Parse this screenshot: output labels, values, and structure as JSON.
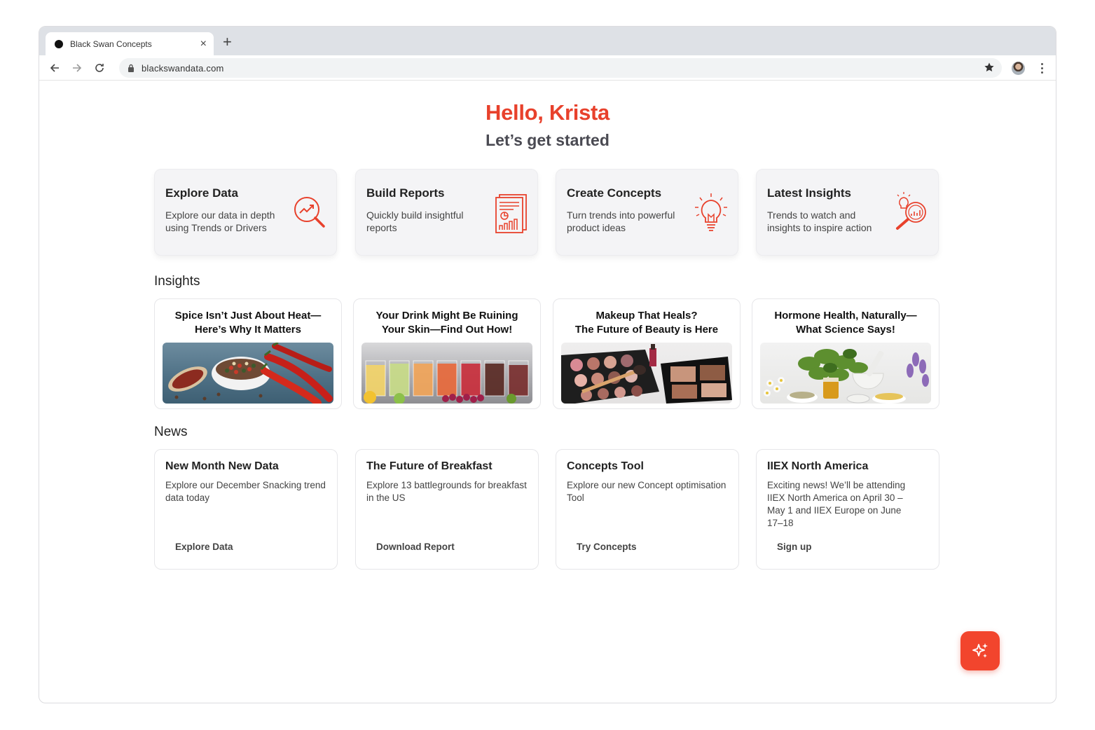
{
  "browser": {
    "tab_title": "Black Swan Concepts",
    "url": "blackswandata.com"
  },
  "greeting": {
    "hello": "Hello, Krista",
    "subtitle": "Let’s get started"
  },
  "quick_actions": [
    {
      "title": "Explore Data",
      "desc": "Explore our data in depth using Trends or Drivers",
      "icon": "trend-magnifier-icon"
    },
    {
      "title": "Build Reports",
      "desc": "Quickly build insightful reports",
      "icon": "report-document-icon"
    },
    {
      "title": "Create Concepts",
      "desc": "Turn trends into powerful product ideas",
      "icon": "lightbulb-icon"
    },
    {
      "title": "Latest Insights",
      "desc": "Trends to watch and insights to inspire action",
      "icon": "insight-magnifier-icon"
    }
  ],
  "insights": {
    "heading": "Insights",
    "cards": [
      {
        "title_line1": "Spice Isn’t Just About Heat—",
        "title_line2": "Here’s Why It Matters"
      },
      {
        "title_line1": "Your Drink Might Be Ruining",
        "title_line2": "Your Skin—Find Out How!"
      },
      {
        "title_line1": "Makeup That Heals?",
        "title_line2": "The Future of Beauty is Here"
      },
      {
        "title_line1": "Hormone Health, Naturally—",
        "title_line2": "What Science Says!"
      }
    ]
  },
  "news": {
    "heading": "News",
    "cards": [
      {
        "title": "New Month New Data",
        "desc": "Explore our December Snacking trend data today",
        "link": "Explore Data"
      },
      {
        "title": "The Future of Breakfast",
        "desc": "Explore 13 battlegrounds for breakfast in the US",
        "link": "Download Report"
      },
      {
        "title": "Concepts Tool",
        "desc": "Explore our new Concept optimisation Tool",
        "link": "Try Concepts"
      },
      {
        "title": "IIEX North America",
        "desc": "Exciting news! We’ll be attending IIEX North America on April 30 – May 1 and IIEX Europe on June 17–18",
        "link": "Sign up"
      }
    ]
  },
  "colors": {
    "accent": "#e8412c",
    "fab": "#f2452d"
  }
}
